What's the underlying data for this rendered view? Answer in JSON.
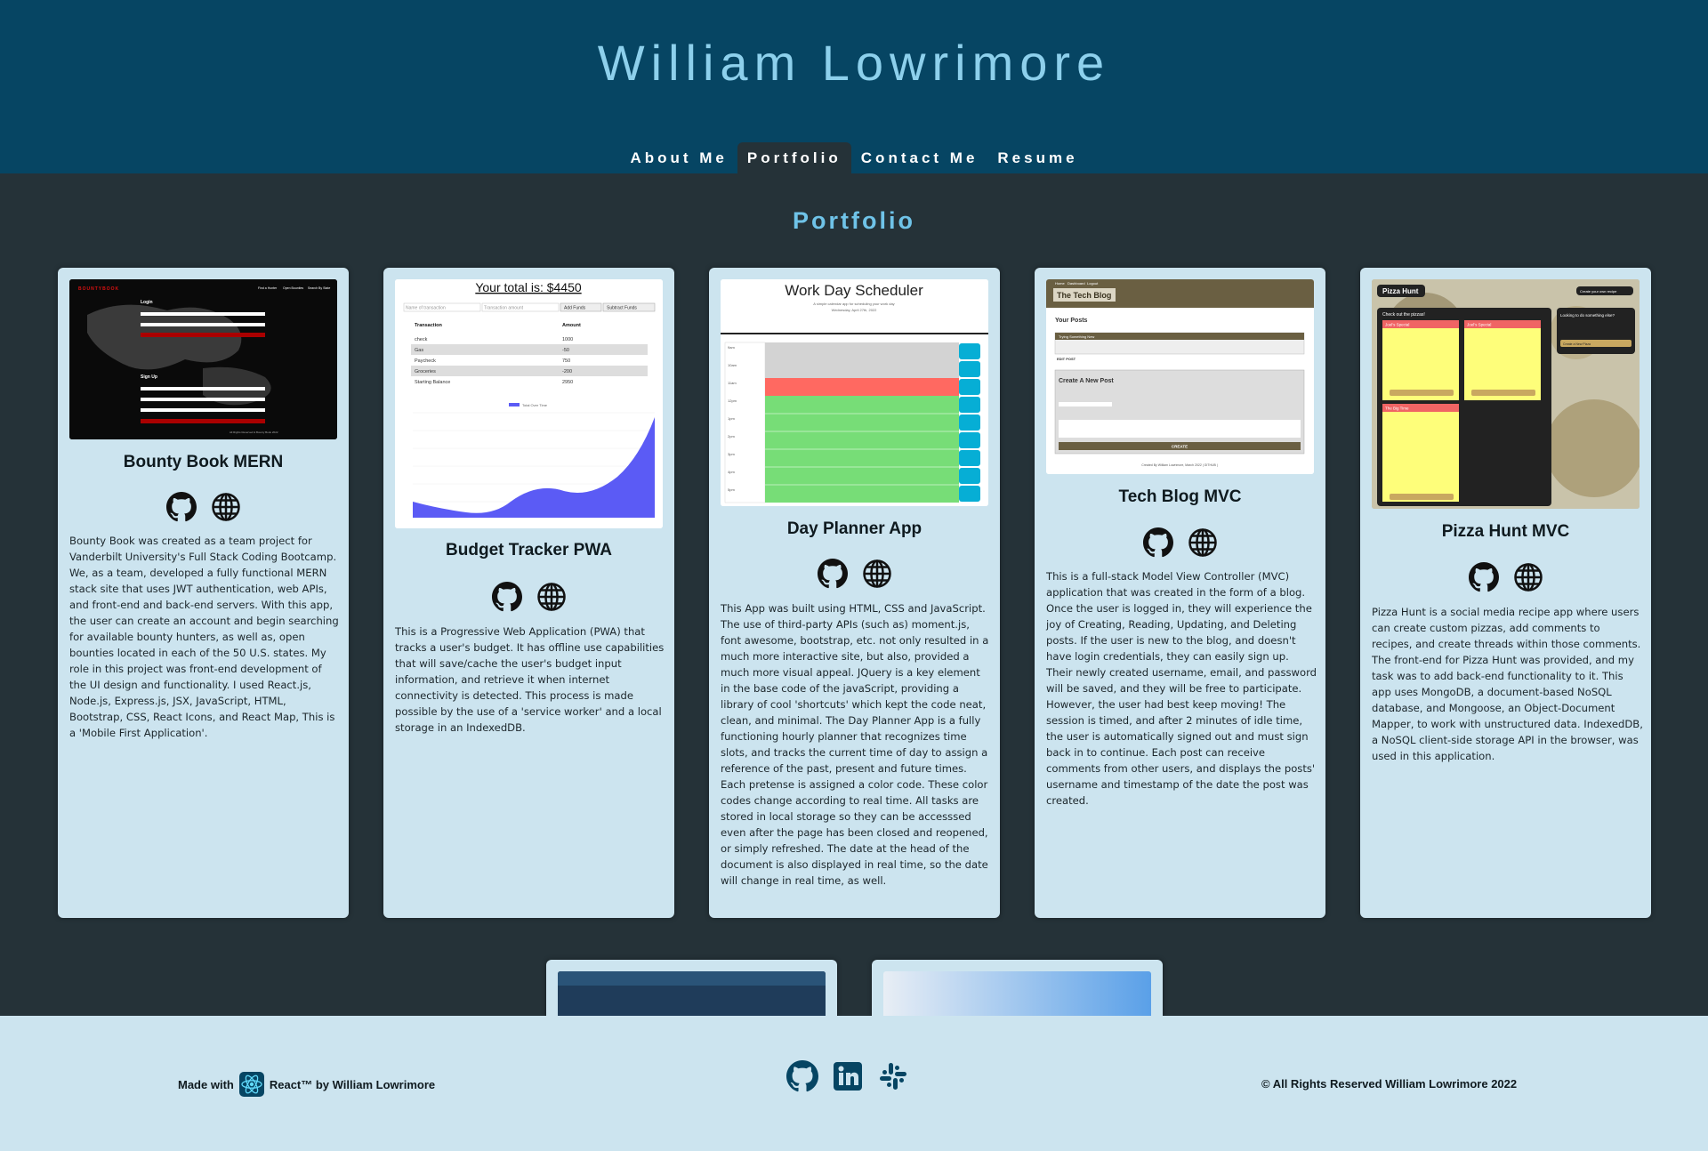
{
  "header": {
    "title": "William Lowrimore",
    "nav": [
      {
        "label": "About Me"
      },
      {
        "label": "Portfolio"
      },
      {
        "label": "Contact Me"
      },
      {
        "label": "Resume"
      }
    ],
    "active_nav": "Portfolio"
  },
  "main": {
    "title": "Portfolio",
    "projects": [
      {
        "title": "Bounty Book MERN",
        "description": "Bounty Book was created as a team project for Vanderbilt University's Full Stack Coding Bootcamp. We, as a team, developed a fully functional MERN stack site that uses JWT authentication, web APIs, and front-end and back-end servers. With this app, the user can create an account and begin searching for available bounty hunters, as well as, open bounties located in each of the 50 U.S. states. My role in this project was front-end development of the UI design and functionality. I used React.js, Node.js, Express.js, JSX, JavaScript, HTML, Bootstrap, CSS, React Icons, and React Map, This is a 'Mobile First Application'.",
        "screenshot": {
          "brand": "BOUNTYBOOK",
          "nav": [
            "Find a Hunter",
            "Open Bounties",
            "Search By State"
          ],
          "login_label": "Login",
          "signup_label": "Sign Up",
          "button": "Signin",
          "signup_button": "Signup",
          "footer": "All Rights Reserved & Bounty Book 2022"
        }
      },
      {
        "title": "Budget Tracker PWA",
        "description": "This is a Progressive Web Application (PWA) that tracks a user's budget. It has offline use capabilities that will save/cache the user's budget input information, and retrieve it when internet connectivity is detected. This process is made possible by the use of a 'service worker' and a local storage in an IndexedDB.",
        "screenshot": {
          "total": "Your total is: $4450",
          "name_placeholder": "Name of transaction",
          "amount_placeholder": "Transaction amount",
          "add_button": "Add Funds",
          "subtract_button": "Subtract Funds",
          "table_headers": [
            "Transaction",
            "Amount"
          ],
          "rows": [
            [
              "check",
              "1000"
            ],
            [
              "Gas",
              "-50"
            ],
            [
              "Paycheck",
              "750"
            ],
            [
              "Groceries",
              "-200"
            ],
            [
              "Starting Balance",
              "2950"
            ]
          ],
          "legend": "Total Over Time",
          "color": "#5b5bf5"
        }
      },
      {
        "title": "Day Planner App",
        "description": "This App was built using HTML, CSS and JavaScript. The use of third-party APIs (such as) moment.js, font awesome, bootstrap, etc. not only resulted in a much more interactive site, but also, provided a much more visual appeal. JQuery is a key element in the base code of the javaScript, providing a library of cool 'shortcuts' which kept the code neat, clean, and minimal. The Day Planner App is a fully functioning hourly planner that recognizes time slots, and tracks the current time of day to assign a reference of the past, present and future times. Each pretense is assigned a color code. These color codes change according to real time. All tasks are stored in local storage so they can be accesssed even after the page has been closed and reopened, or simply refreshed. The date at the head of the document is also displayed in real time, so the date will change in real time, as well.",
        "screenshot": {
          "title": "Work Day Scheduler",
          "subtitle": "A simple calendar app for scheduling your work day",
          "date": "Wednesday, April 27th, 2022",
          "hours": [
            "9am",
            "10am",
            "11am",
            "12pm",
            "1pm",
            "2pm",
            "3pm",
            "4pm",
            "5pm"
          ],
          "states": [
            "past",
            "past",
            "present",
            "future",
            "future",
            "future",
            "future",
            "future",
            "future"
          ],
          "colors": {
            "past": "#d3d3d3",
            "present": "#ff6961",
            "future": "#77dd77",
            "save": "#06aed5"
          }
        }
      },
      {
        "title": "Tech Blog MVC",
        "description": "This is a full-stack Model View Controller (MVC) application that was created in the form of a blog. Once the user is logged in, they will experience the joy of Creating, Reading, Updating, and Deleting posts. If the user is new to the blog, and doesn't have login credentials, they can easily sign up. Their newly created username, email, and password will be saved, and they will be free to participate. However, the user had best keep moving! The session is timed, and after 2 minutes of idle time, the user is automatically signed out and must sign back in to continue. Each post can receive comments from other users, and displays the posts' username and timestamp of the date the post was created.",
        "screenshot": {
          "nav": [
            "Home",
            "Dashboard",
            "Logout"
          ],
          "brand": "The Tech Blog",
          "your_posts": "Your Posts",
          "post_title": "Trying Something New",
          "edit_post": "EDIT POST",
          "new_post": "Create A New Post",
          "create_button": "CREATE",
          "footer": "Created By William Lowrimore, March 2022 | GITHUB |"
        }
      },
      {
        "title": "Pizza Hunt MVC",
        "description": "Pizza Hunt is a social media recipe app where users can create custom pizzas, add comments to recipes, and create threads within those comments. The front-end for Pizza Hunt was provided, and my task was to add back-end functionality to it. This app uses MongoDB, a document-based NoSQL database, and Mongoose, an Object-Document Mapper, to work with unstructured data. IndexedDB, a NoSQL client-side storage API in the browser, was used in this application.",
        "screenshot": {
          "brand": "Pizza Hunt",
          "create_label": "Create your own recipe",
          "check_out": "Check out the pizzas!",
          "looking": "Looking to do something else?",
          "create_pizza": "Create a New Pizza",
          "pizzas": [
            "Joel's Special",
            "Joel's Special",
            "The Big Time"
          ]
        }
      }
    ]
  },
  "footer": {
    "made_with": "Made with",
    "react": "React™ by William Lowrimore",
    "copyright": "© All Rights Reserved William Lowrimore 2022",
    "social": [
      "github-icon",
      "linkedin-icon",
      "slack-icon"
    ]
  },
  "colors": {
    "header_bg": "#064563",
    "title": "#8dd0ec",
    "page_bg": "#253238",
    "card_bg": "#cce4ef",
    "portfolio_title": "#6fc3e8"
  }
}
